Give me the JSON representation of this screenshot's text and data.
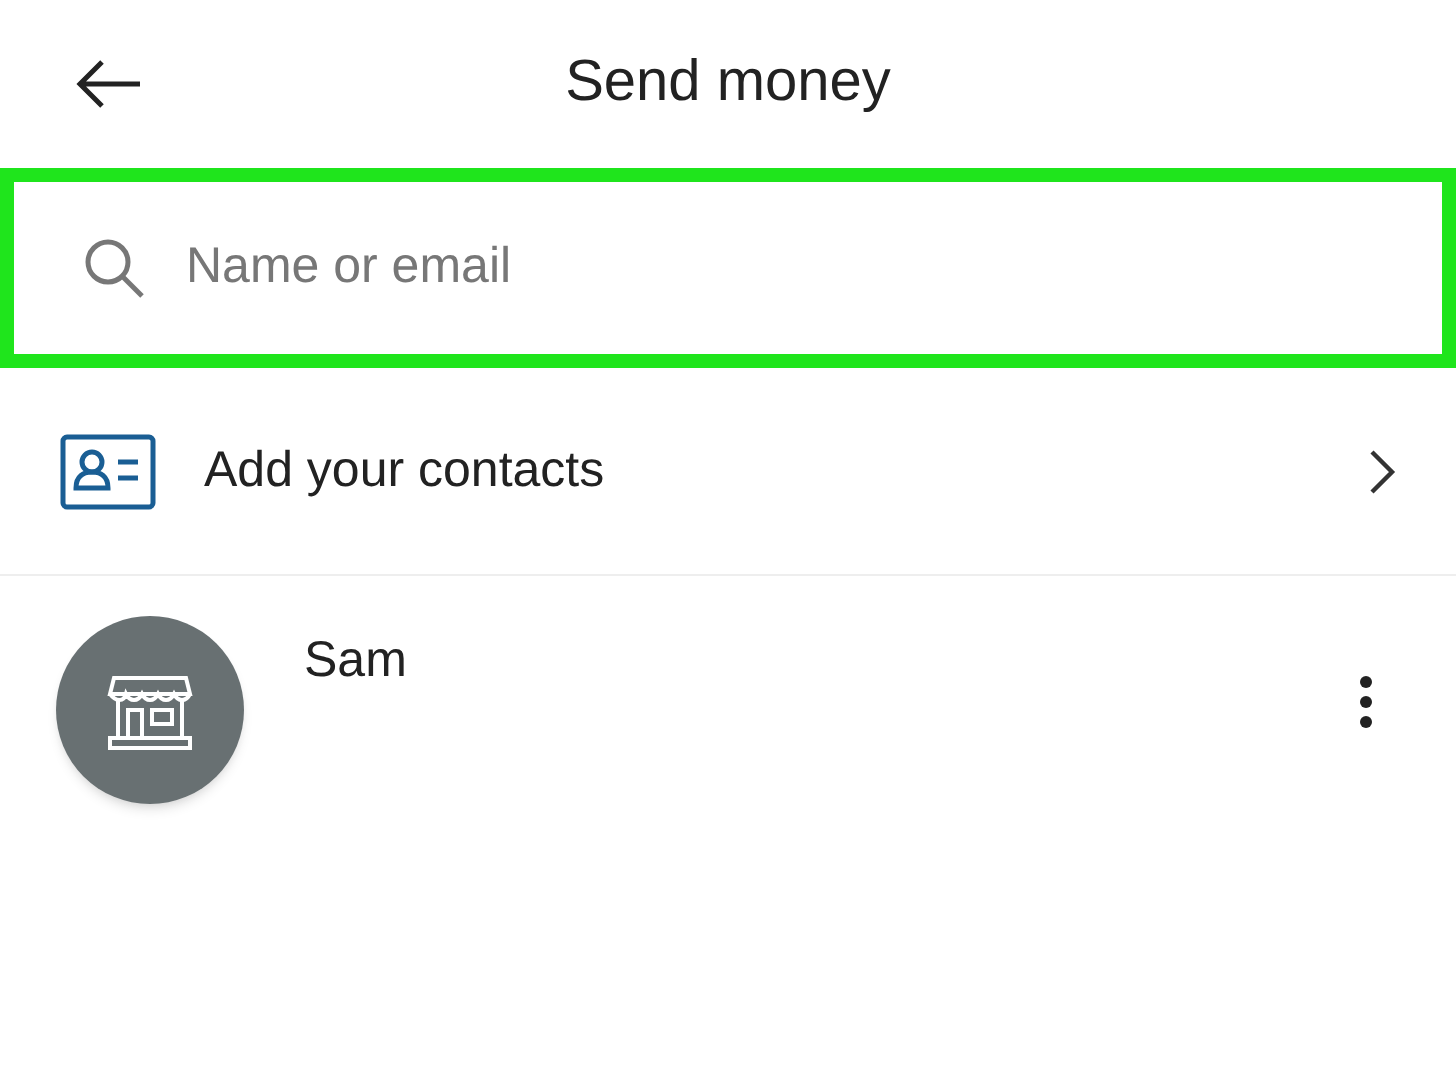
{
  "header": {
    "title": "Send money"
  },
  "search": {
    "placeholder": "Name or email",
    "highlighted": true
  },
  "add_contacts": {
    "label": "Add your contacts"
  },
  "contacts": [
    {
      "name": "Sam",
      "kind": "store"
    }
  ]
}
